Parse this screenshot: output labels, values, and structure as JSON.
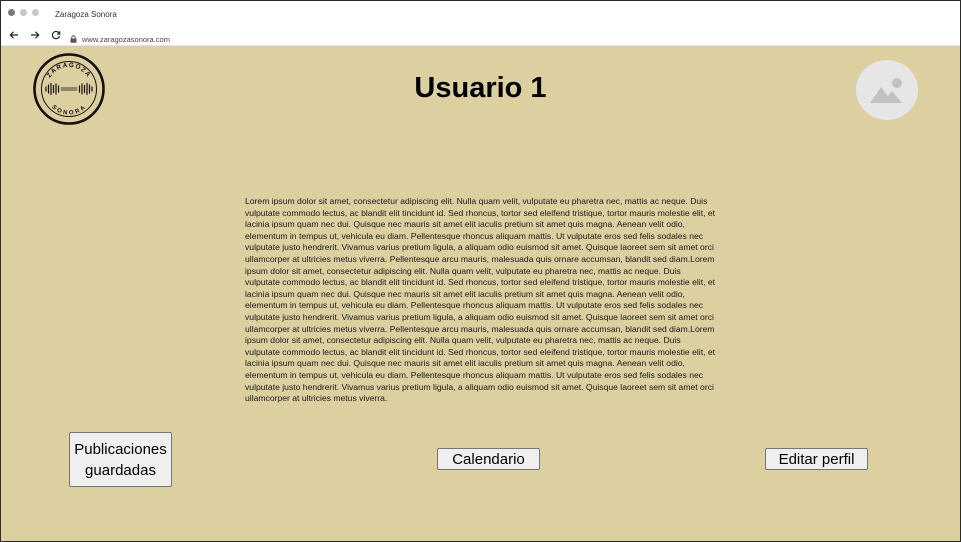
{
  "browser": {
    "tab_title": "Zaragoza Sonora",
    "url": "www.zaragozasonora.com",
    "dot_colors": [
      "#7a7a7a",
      "#c8c8c8",
      "#c8c8c8"
    ]
  },
  "logo": {
    "text_top": "ZARAGOZA",
    "text_bottom": "SONORA"
  },
  "header": {
    "title": "Usuario 1"
  },
  "profile": {
    "bio": "Lorem ipsum dolor sit amet, consectetur adipiscing elit. Nulla quam velit, vulputate eu pharetra nec, mattis ac neque. Duis vulputate commodo lectus, ac blandit elit tincidunt id. Sed rhoncus, tortor sed eleifend tristique, tortor mauris molestie elit, et lacinia ipsum quam nec dui. Quisque nec mauris sit amet elit iaculis pretium sit amet quis magna. Aenean velit odio, elementum in tempus ut, vehicula eu diam. Pellentesque rhoncus aliquam mattis. Ut vulputate eros sed felis sodales nec vulputate justo hendrerit. Vivamus varius pretium ligula, a aliquam odio euismod sit amet. Quisque laoreet sem sit amet orci ullamcorper at ultricies metus viverra. Pellentesque arcu mauris, malesuada quis ornare accumsan, blandit sed diam.Lorem ipsum dolor sit amet, consectetur adipiscing elit. Nulla quam velit, vulputate eu pharetra nec, mattis ac neque. Duis vulputate commodo lectus, ac blandit elit tincidunt id. Sed rhoncus, tortor sed eleifend tristique, tortor mauris molestie elit, et lacinia ipsum quam nec dui. Quisque nec mauris sit amet elit iaculis pretium sit amet quis magna. Aenean velit odio, elementum in tempus ut, vehicula eu diam. Pellentesque rhoncus aliquam mattis. Ut vulputate eros sed felis sodales nec vulputate justo hendrerit. Vivamus varius pretium ligula, a aliquam odio euismod sit amet. Quisque laoreet sem sit amet orci ullamcorper at ultricies metus viverra. Pellentesque arcu mauris, malesuada quis ornare accumsan, blandit sed diam.Lorem ipsum dolor sit amet, consectetur adipiscing elit. Nulla quam velit, vulputate eu pharetra nec, mattis ac neque. Duis vulputate commodo lectus, ac blandit elit tincidunt id. Sed rhoncus, tortor sed eleifend tristique, tortor mauris molestie elit, et lacinia ipsum quam nec dui. Quisque nec mauris sit amet elit iaculis pretium sit amet quis magna. Aenean velit odio, elementum in tempus ut, vehicula eu diam. Pellentesque rhoncus aliquam mattis. Ut vulputate eros sed felis sodales nec vulputate justo hendrerit. Vivamus varius pretium ligula, a aliquam odio euismod sit amet. Quisque laoreet sem sit amet orci ullamcorper at ultricies metus viverra."
  },
  "actions": {
    "saved_posts_label": "Publicaciones guardadas",
    "calendar_label": "Calendario",
    "edit_profile_label": "Editar perfil"
  },
  "icons": {
    "avatar": "image-placeholder-icon",
    "logo": "soundwave-logo"
  },
  "colors": {
    "page_background": "#dccfa0",
    "avatar_background": "#e6e6e6",
    "button_background": "#efefef"
  }
}
